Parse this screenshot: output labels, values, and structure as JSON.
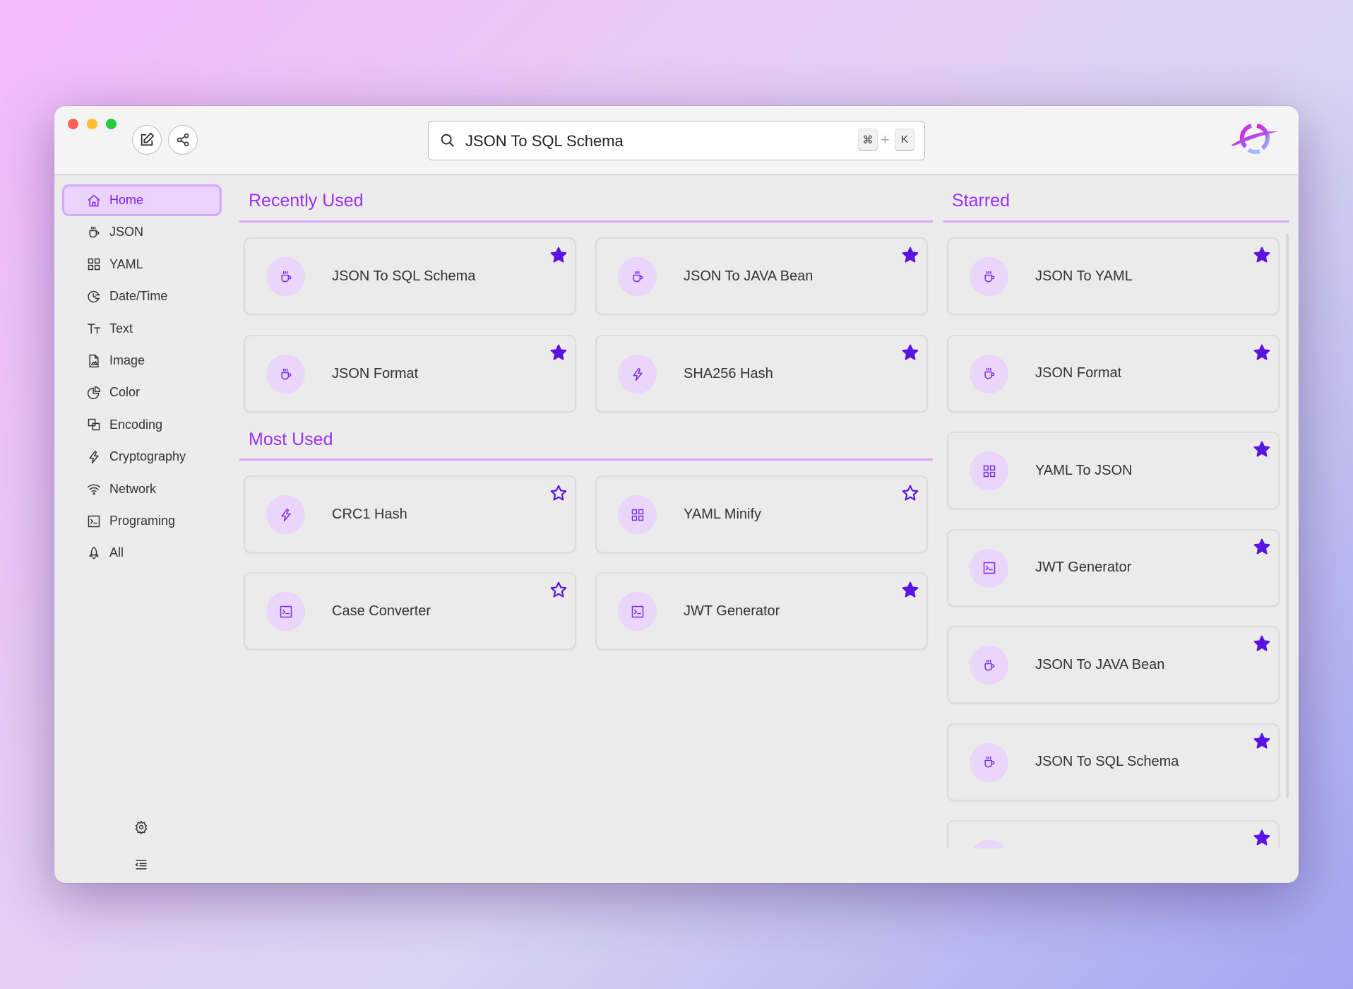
{
  "window": {
    "traffic_lights": {
      "close": "#fe5f57",
      "minimize": "#febc2e",
      "zoom": "#28c840"
    },
    "toolbar": {
      "edit_icon": "edit-icon",
      "share_icon": "share-icon"
    },
    "search": {
      "value": "JSON To SQL Schema",
      "placeholder": "",
      "shortcut_key1": "⌘",
      "shortcut_plus": "+",
      "shortcut_key2": "K"
    },
    "logo": "app-logo"
  },
  "colors": {
    "accent": "#9b30f5",
    "star": "#5a14e2",
    "icon": "#7a2ee6",
    "icon_bg": "#ead5fb",
    "underline": "#d7a7fb"
  },
  "sidebar": {
    "items": [
      {
        "label": "Home",
        "icon": "home",
        "active": true
      },
      {
        "label": "JSON",
        "icon": "cup"
      },
      {
        "label": "YAML",
        "icon": "grid"
      },
      {
        "label": "Date/Time",
        "icon": "clock"
      },
      {
        "label": "Text",
        "icon": "text"
      },
      {
        "label": "Image",
        "icon": "image"
      },
      {
        "label": "Color",
        "icon": "pie"
      },
      {
        "label": "Encoding",
        "icon": "layers"
      },
      {
        "label": "Cryptography",
        "icon": "bolt"
      },
      {
        "label": "Network",
        "icon": "wifi"
      },
      {
        "label": "Programing",
        "icon": "terminal"
      },
      {
        "label": "All",
        "icon": "rocket"
      }
    ],
    "settings_icon": "gear-icon",
    "collapse_icon": "collapse-icon"
  },
  "main": {
    "recently_used": {
      "title": "Recently Used",
      "cards": [
        {
          "name": "JSON To SQL Schema",
          "icon": "cup",
          "starred": true
        },
        {
          "name": "JSON To JAVA Bean",
          "icon": "cup",
          "starred": true
        },
        {
          "name": "JSON Format",
          "icon": "cup",
          "starred": true
        },
        {
          "name": "SHA256 Hash",
          "icon": "bolt",
          "starred": true
        }
      ]
    },
    "most_used": {
      "title": "Most Used",
      "cards": [
        {
          "name": "CRC1 Hash",
          "icon": "bolt",
          "starred": false
        },
        {
          "name": "YAML Minify",
          "icon": "grid",
          "starred": false
        },
        {
          "name": "Case Converter",
          "icon": "terminal",
          "starred": false
        },
        {
          "name": "JWT Generator",
          "icon": "terminal",
          "starred": true
        }
      ]
    },
    "starred": {
      "title": "Starred",
      "cards": [
        {
          "name": "JSON To YAML",
          "icon": "cup",
          "starred": true
        },
        {
          "name": "JSON Format",
          "icon": "cup",
          "starred": true
        },
        {
          "name": "YAML To JSON",
          "icon": "grid",
          "starred": true
        },
        {
          "name": "JWT Generator",
          "icon": "terminal",
          "starred": true
        },
        {
          "name": "JSON To JAVA Bean",
          "icon": "cup",
          "starred": true
        },
        {
          "name": "JSON To SQL Schema",
          "icon": "cup",
          "starred": true
        },
        {
          "name": "",
          "icon": "cup",
          "starred": true
        }
      ]
    }
  }
}
